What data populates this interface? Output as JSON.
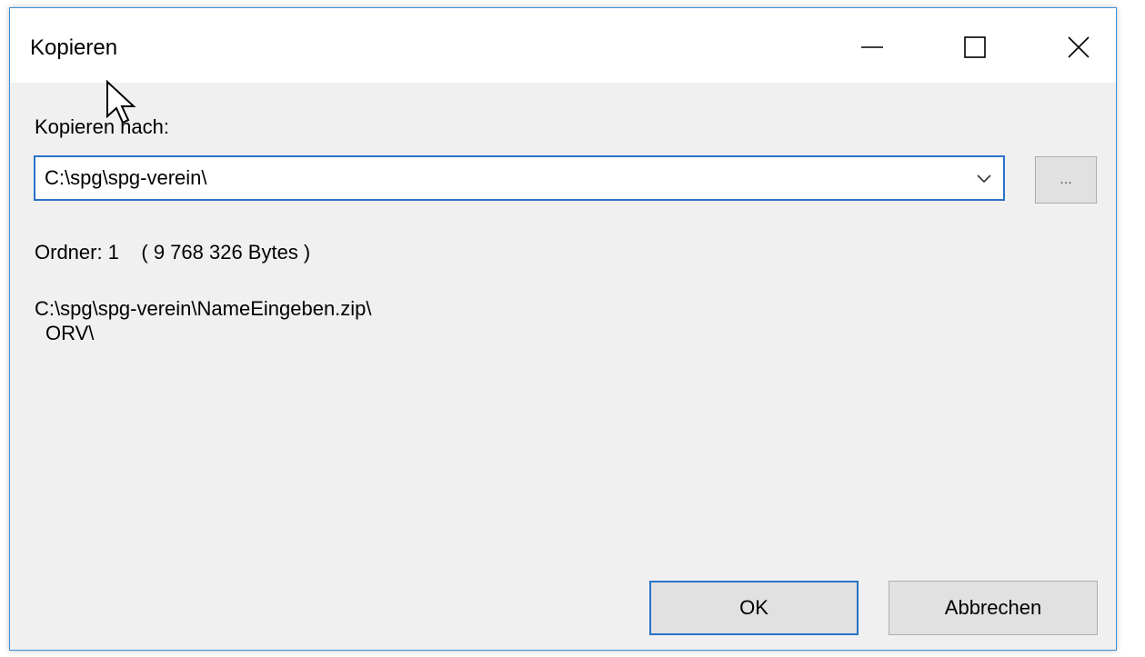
{
  "window": {
    "title": "Kopieren",
    "controls": {
      "minimize_icon": "minimize-icon",
      "maximize_icon": "maximize-icon",
      "close_icon": "close-icon"
    }
  },
  "destination": {
    "label": "Kopieren nach:",
    "value": "C:\\spg\\spg-verein\\",
    "browse_label": "..."
  },
  "info": {
    "folders_text": "Ordner: 1    ( 9 768 326 Bytes )"
  },
  "paths": [
    "C:\\spg\\spg-verein\\NameEingeben.zip\\",
    "ORV\\"
  ],
  "buttons": {
    "ok_label": "OK",
    "cancel_label": "Abbrechen"
  },
  "colors": {
    "accent": "#2a73c8",
    "dialog_bg": "#f0f0f0",
    "button_bg": "#e1e1e1"
  }
}
